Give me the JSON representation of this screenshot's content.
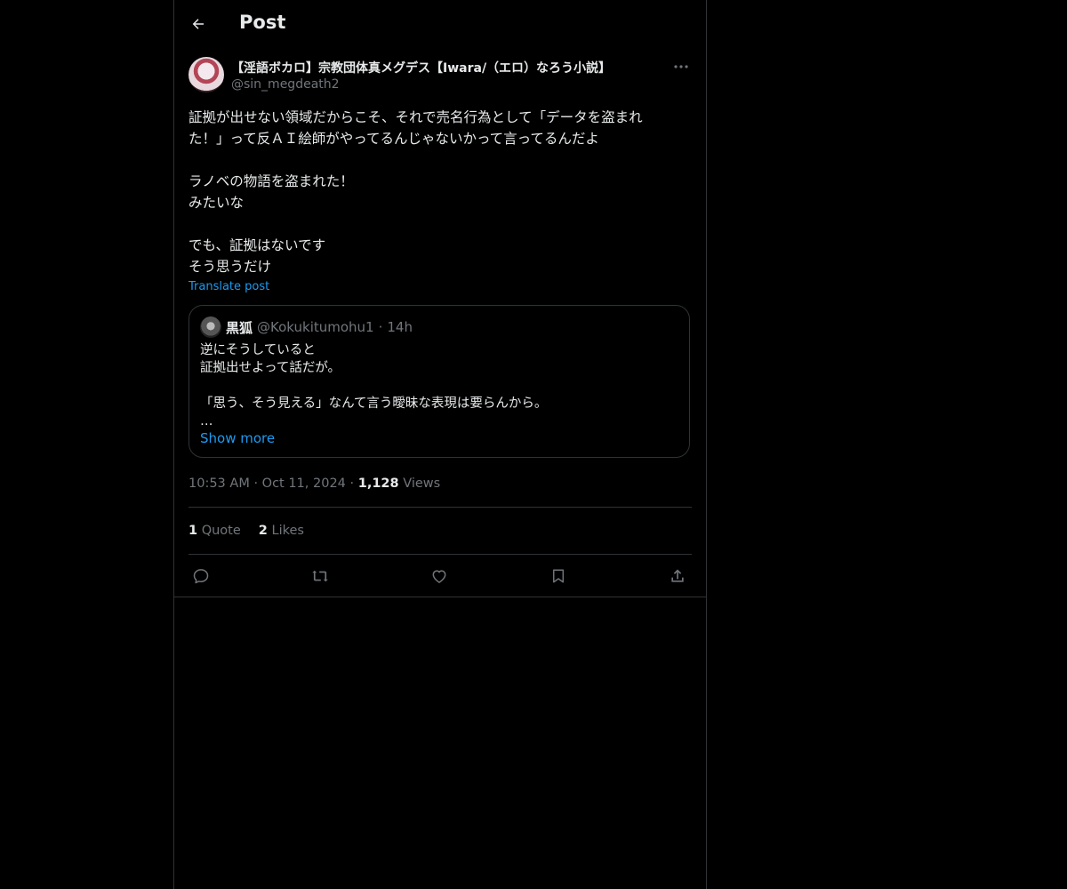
{
  "header": {
    "title": "Post",
    "back_icon": "arrow-left-icon"
  },
  "post": {
    "author": {
      "display_name": "【淫語ボカロ】宗教団体真メグデス【Iwara/（エロ）なろう小説】",
      "handle": "@sin_megdeath2"
    },
    "text_lines": [
      "証拠が出せない領域だからこそ、それで売名行為として「データを盗まれ",
      "た！」って反ＡＩ絵師がやってるんじゃないかって言ってるんだよ",
      "",
      "ラノベの物語を盗まれた！",
      "みたいな",
      "",
      "でも、証拠はないです",
      "そう思うだけ"
    ],
    "translate_label": "Translate post",
    "quote": {
      "name": "黒狐",
      "handle": "@Kokukitumohu1",
      "dot": "·",
      "time": "14h",
      "lines": [
        "逆にそうしていると",
        "証拠出せよって話だが。",
        "",
        "「思う、そう見える」なんて言う曖昧な表現は要らんから。",
        "…"
      ],
      "show_more": "Show more"
    },
    "meta": {
      "time": "10:53 AM",
      "dot1": "·",
      "date": "Oct 11, 2024",
      "dot2": "·",
      "views_count": "1,128",
      "views_label": "Views"
    },
    "stats": {
      "quotes_count": "1",
      "quotes_label": "Quote",
      "likes_count": "2",
      "likes_label": "Likes"
    },
    "actions": [
      "reply-icon",
      "repost-icon",
      "like-icon",
      "bookmark-icon",
      "share-icon"
    ]
  },
  "colors": {
    "background": "#000000",
    "text": "#e7e9ea",
    "muted": "#71767b",
    "accent": "#1d9bf0",
    "border": "#2f3336"
  }
}
